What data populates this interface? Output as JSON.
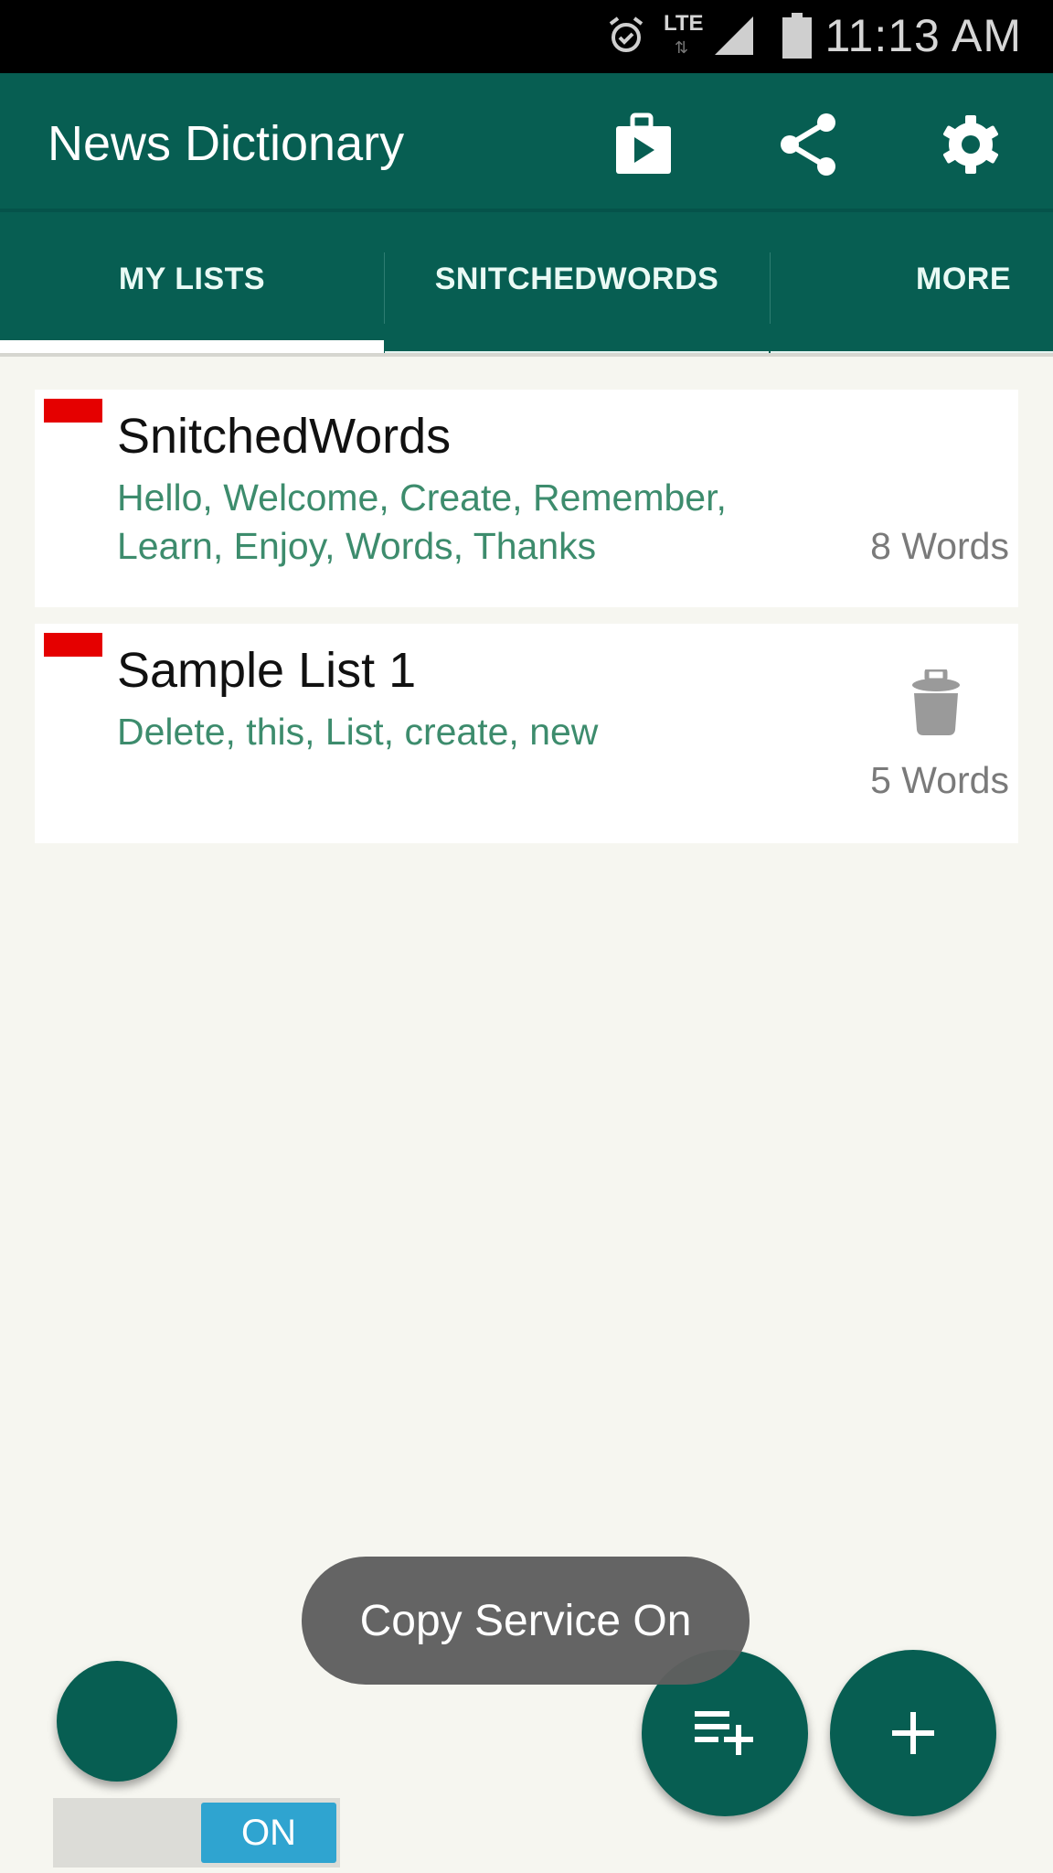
{
  "status_bar": {
    "time": "11:13 AM",
    "network_label": "LTE",
    "icons": [
      "alarm-icon",
      "lte-icon",
      "signal-icon",
      "battery-icon"
    ]
  },
  "app_bar": {
    "title": "News Dictionary",
    "actions": [
      {
        "name": "play-store",
        "icon": "play-store-icon"
      },
      {
        "name": "share",
        "icon": "share-icon"
      },
      {
        "name": "settings",
        "icon": "gear-icon"
      }
    ]
  },
  "tabs": [
    {
      "label": "MY LISTS",
      "selected": true
    },
    {
      "label": "SNITCHEDWORDS",
      "selected": false
    },
    {
      "label": "MORE",
      "selected": false
    }
  ],
  "lists": [
    {
      "title": "SnitchedWords",
      "words": "Hello, Welcome, Create, Remember, Learn, Enjoy, Words, Thanks",
      "count": "8 Words",
      "flag_color": "#e50000",
      "deletable": false
    },
    {
      "title": "Sample List 1",
      "words": "Delete, this, List, create, new",
      "count": "5 Words",
      "flag_color": "#e50000",
      "deletable": true
    }
  ],
  "toast": {
    "message": "Copy Service On"
  },
  "copy_service_toggle": {
    "label": "ON",
    "state": "on"
  },
  "fabs": [
    {
      "name": "service",
      "icon": "none"
    },
    {
      "name": "add-to-list",
      "icon": "playlist-add-icon"
    },
    {
      "name": "add",
      "icon": "plus-icon"
    }
  ],
  "colors": {
    "primary": "#075e52",
    "accent_text": "#3d8c6d",
    "flag": "#e50000",
    "toggle_on": "#2fa4d0",
    "background": "#f6f6f0"
  }
}
